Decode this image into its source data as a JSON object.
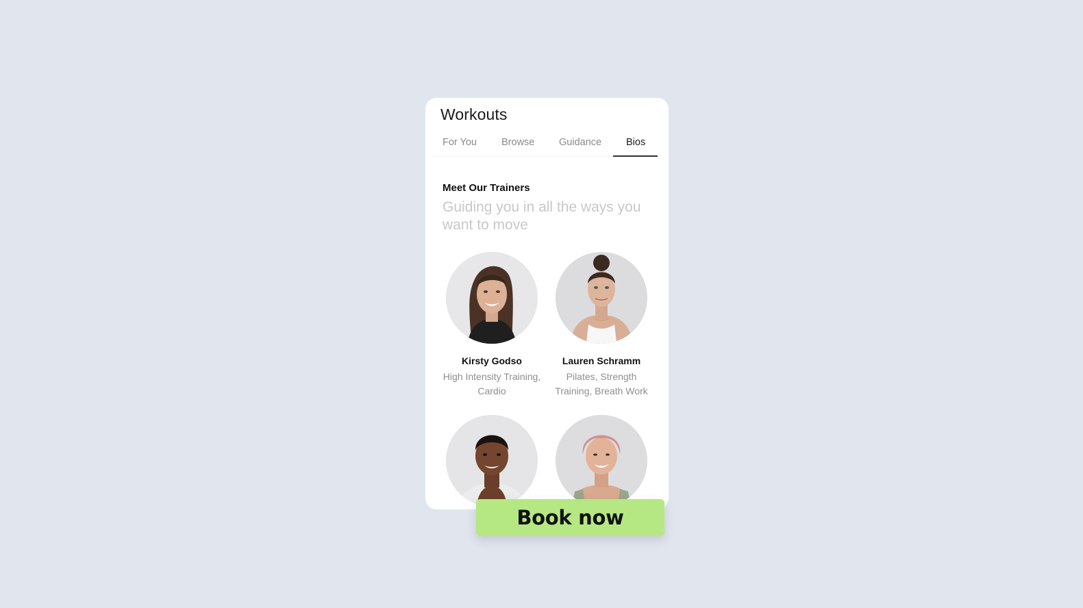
{
  "header": {
    "title": "Workouts"
  },
  "tabs": [
    {
      "label": "For You",
      "active": false
    },
    {
      "label": "Browse",
      "active": false
    },
    {
      "label": "Guidance",
      "active": false
    },
    {
      "label": "Bios",
      "active": true
    }
  ],
  "section": {
    "title": "Meet Our Trainers",
    "subtitle": "Guiding you in all the ways you want to move"
  },
  "trainers": [
    {
      "name": "Kirsty Godso",
      "specialty": "High Intensity Training, Cardio",
      "photo": "trainer-portrait"
    },
    {
      "name": "Lauren Schramm",
      "specialty": "Pilates, Strength Training, Breath Work",
      "photo": "trainer-portrait"
    },
    {
      "name": "",
      "specialty": "",
      "photo": "trainer-portrait"
    },
    {
      "name": "",
      "specialty": "",
      "photo": "trainer-portrait"
    }
  ],
  "cta": {
    "label": "Book now",
    "color": "#b5e882"
  },
  "colors": {
    "background": "#e1e5ee",
    "card": "#ffffff",
    "muted_text": "#8e8e8e",
    "subtitle_text": "#c8c8c8"
  }
}
